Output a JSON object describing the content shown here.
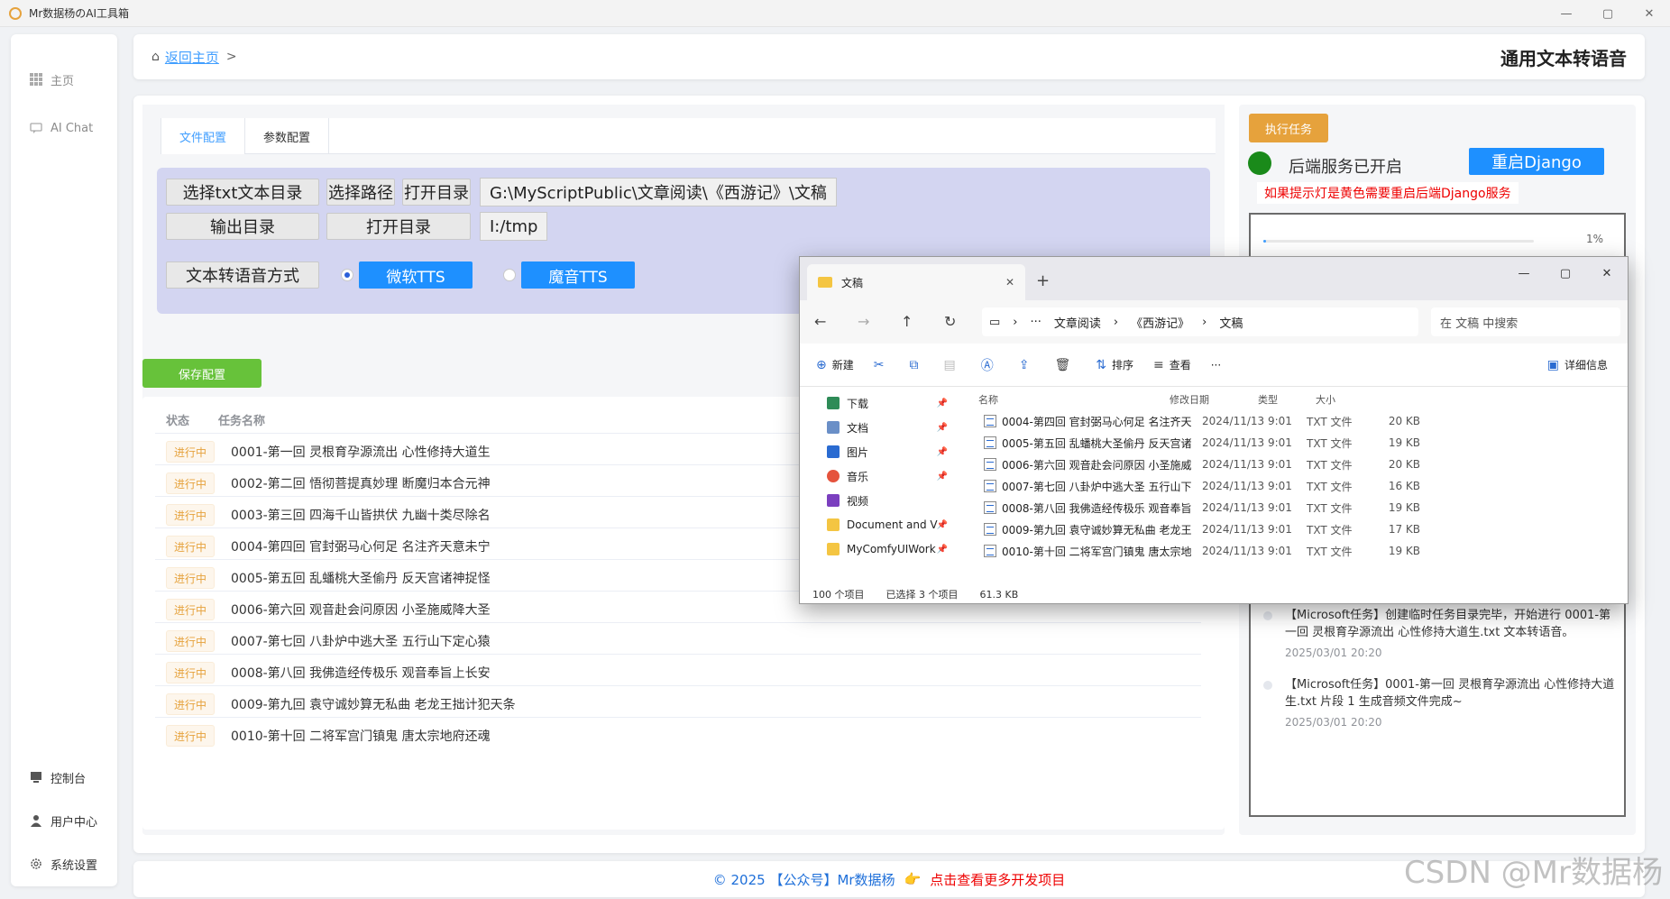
{
  "window": {
    "title": "Mr数据杨のAI工具箱",
    "controls": [
      "—",
      "▢",
      "✕"
    ]
  },
  "sidebar": {
    "top_items": [
      {
        "label": "主页",
        "icon": "grid-icon"
      },
      {
        "label": "AI Chat",
        "icon": "chat-icon"
      }
    ],
    "bottom_items": [
      {
        "label": "控制台",
        "icon": "monitor-icon"
      },
      {
        "label": "用户中心",
        "icon": "user-icon"
      },
      {
        "label": "系统设置",
        "icon": "gear-icon"
      }
    ]
  },
  "header": {
    "back_label": "返回主页",
    "separator": ">",
    "page_title": "通用文本转语音"
  },
  "config": {
    "tabs": [
      "文件配置",
      "参数配置"
    ],
    "select_txt_dir": "选择txt文本目录",
    "select_path": "选择路径",
    "open_dir_1": "打开目录",
    "input_path": "G:\\MyScriptPublic\\文章阅读\\《西游记》\\文稿",
    "output_dir": "输出目录",
    "open_dir_2": "打开目录",
    "output_path": "I:/tmp",
    "tts_method": "文本转语音方式",
    "tts_option_1": "微软TTS",
    "tts_option_2": "魔音TTS",
    "save_button": "保存配置"
  },
  "tasks": {
    "headers": [
      "状态",
      "任务名称"
    ],
    "rows": [
      {
        "status": "进行中",
        "name": "0001-第一回 灵根育孕源流出 心性修持大道生"
      },
      {
        "status": "进行中",
        "name": "0002-第二回 悟彻菩提真妙理 断魔归本合元神"
      },
      {
        "status": "进行中",
        "name": "0003-第三回 四海千山皆拱伏 九幽十类尽除名"
      },
      {
        "status": "进行中",
        "name": "0004-第四回 官封弼马心何足 名注齐天意未宁"
      },
      {
        "status": "进行中",
        "name": "0005-第五回 乱蟠桃大圣偷丹 反天宫诸神捉怪"
      },
      {
        "status": "进行中",
        "name": "0006-第六回 观音赴会问原因 小圣施威降大圣"
      },
      {
        "status": "进行中",
        "name": "0007-第七回 八卦炉中逃大圣 五行山下定心猿"
      },
      {
        "status": "进行中",
        "name": "0008-第八回 我佛造经传极乐 观音奉旨上长安"
      },
      {
        "status": "进行中",
        "name": "0009-第九回 袁守诚妙算无私曲 老龙王拙计犯天条"
      },
      {
        "status": "进行中",
        "name": "0010-第十回 二将军宫门镇鬼 唐太宗地府还魂"
      }
    ]
  },
  "right": {
    "exec_button": "执行任务",
    "service_status": "后端服务已开启",
    "restart_button": "重启Django",
    "warning": "如果提示灯是黄色需要重启后端Django服务",
    "progress_percent": 1,
    "progress_label": "1%",
    "logs": [
      {
        "text": "【Microsoft任务】创建临时任务目录完毕，开始进行 0001-第一回 灵根育孕源流出 心性修持大道生.txt 文本转语音。",
        "time": "2025/03/01 20:20"
      },
      {
        "text": "【Microsoft任务】0001-第一回 灵根育孕源流出 心性修持大道生.txt 片段 1 生成音频文件完成~",
        "time": "2025/03/01 20:20"
      }
    ]
  },
  "footer": {
    "copyright": "© 2025 【公众号】Mr数据杨",
    "hand": "👉",
    "more_link": "点击查看更多开发项目"
  },
  "watermark": "CSDN @Mr数据杨",
  "explorer": {
    "tab_title": "文稿",
    "new_tab": "+",
    "breadcrumb": [
      "文章阅读",
      "《西游记》",
      "文稿"
    ],
    "more": "···",
    "search_placeholder": "在 文稿 中搜索",
    "toolbar": {
      "new": "新建",
      "sort": "排序",
      "view": "查看",
      "more": "···",
      "details": "详细信息"
    },
    "nav_items": [
      "下载",
      "文档",
      "图片",
      "音乐",
      "视频",
      "Document and V",
      "MyComfyUIWork"
    ],
    "columns": [
      "名称",
      "修改日期",
      "类型",
      "大小"
    ],
    "files": [
      {
        "name": "0004-第四回 官封弼马心何足 名注齐天...",
        "date": "2024/11/13 9:01",
        "type": "TXT 文件",
        "size": "20 KB"
      },
      {
        "name": "0005-第五回 乱蟠桃大圣偷丹 反天宫诸...",
        "date": "2024/11/13 9:01",
        "type": "TXT 文件",
        "size": "19 KB"
      },
      {
        "name": "0006-第六回 观音赴会问原因 小圣施威...",
        "date": "2024/11/13 9:01",
        "type": "TXT 文件",
        "size": "20 KB"
      },
      {
        "name": "0007-第七回 八卦炉中逃大圣 五行山下...",
        "date": "2024/11/13 9:01",
        "type": "TXT 文件",
        "size": "16 KB"
      },
      {
        "name": "0008-第八回 我佛造经传极乐 观音奉旨...",
        "date": "2024/11/13 9:01",
        "type": "TXT 文件",
        "size": "19 KB"
      },
      {
        "name": "0009-第九回 袁守诚妙算无私曲 老龙王...",
        "date": "2024/11/13 9:01",
        "type": "TXT 文件",
        "size": "17 KB"
      },
      {
        "name": "0010-第十回 二将军宫门镇鬼 唐太宗地...",
        "date": "2024/11/13 9:01",
        "type": "TXT 文件",
        "size": "19 KB"
      }
    ],
    "status": {
      "count": "100 个项目",
      "selected": "已选择 3 个项目",
      "size": "61.3 KB"
    }
  }
}
